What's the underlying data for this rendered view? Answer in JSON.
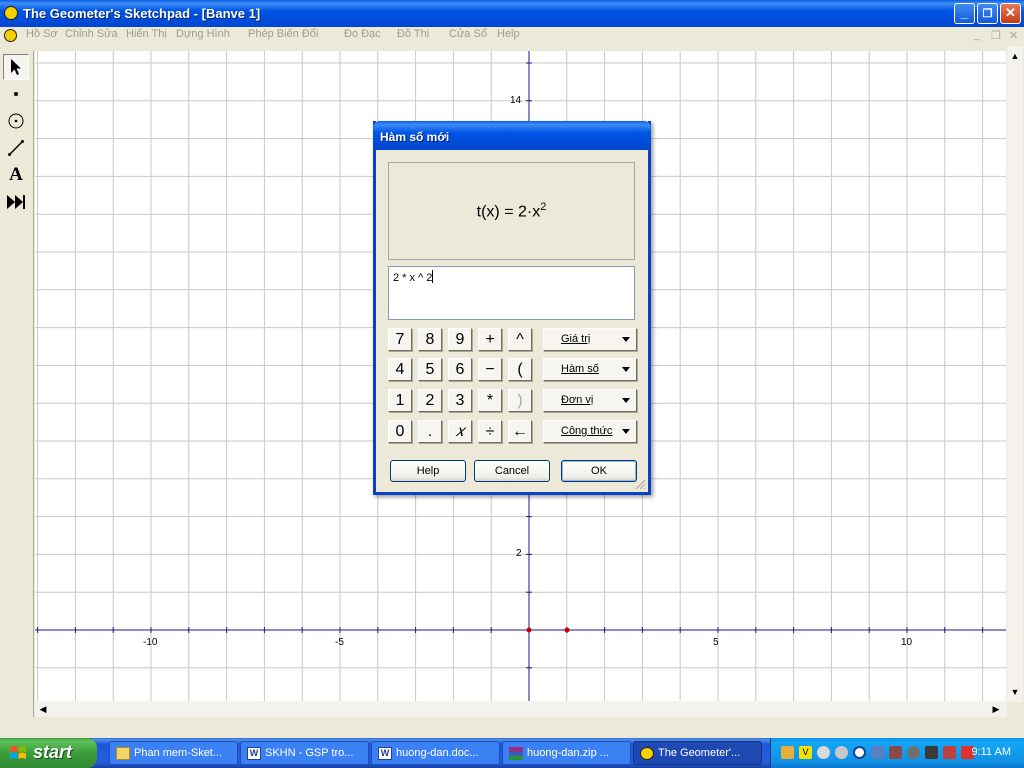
{
  "window": {
    "title": "The Geometer's Sketchpad - [Banve 1]",
    "min_icon": "minimize-icon",
    "restore_icon": "restore-icon",
    "close_icon": "close-icon"
  },
  "menubar": {
    "items": [
      "Hồ Sơ",
      "Chỉnh Sửa",
      "Hiển Thị",
      "Dựng Hình",
      "Phép Biến Đổi",
      "Đo Đạc",
      "Đồ Thị",
      "Cửa Sổ",
      "Help"
    ]
  },
  "toolbox": {
    "tools": [
      "arrow-tool-icon",
      "point-tool-icon",
      "compass-tool-icon",
      "straightedge-tool-icon",
      "text-tool-icon",
      "custom-tool-icon"
    ],
    "text_tool_glyph": "A"
  },
  "graph": {
    "x_tick_labels": [
      "-10",
      "-5",
      "5",
      "10"
    ],
    "y_tick_labels": [
      "14",
      "2"
    ],
    "origin_color": "#cc0000"
  },
  "dialog": {
    "title": "Hàm số mới",
    "preview": "t(x) = 2·x",
    "preview_exponent": "2",
    "expression": "2 * x ^ 2",
    "keypad": {
      "row1": [
        "7",
        "8",
        "9",
        "+",
        "^"
      ],
      "row2": [
        "4",
        "5",
        "6",
        "−",
        "("
      ],
      "row3": [
        "1",
        "2",
        "3",
        "*",
        ")"
      ],
      "row4": [
        "0",
        ".",
        "𝑥",
        "÷",
        "←"
      ]
    },
    "menus": {
      "values": "Giá trị",
      "functions": "Hàm số",
      "units": "Đơn vị",
      "formula": "Công thức"
    },
    "buttons": {
      "help": "Help",
      "cancel": "Cancel",
      "ok": "OK"
    }
  },
  "taskbar": {
    "start": "start",
    "tasks": [
      {
        "label": "Phan mem-Sket...",
        "icon": "folder-icon"
      },
      {
        "label": "SKHN - GSP tro...",
        "icon": "word-icon"
      },
      {
        "label": "huong-dan.doc...",
        "icon": "word-icon"
      },
      {
        "label": "huong-dan.zip ...",
        "icon": "winrar-icon"
      },
      {
        "label": "The Geometer'...",
        "icon": "sketchpad-icon"
      }
    ],
    "clock": "9:11 AM"
  }
}
